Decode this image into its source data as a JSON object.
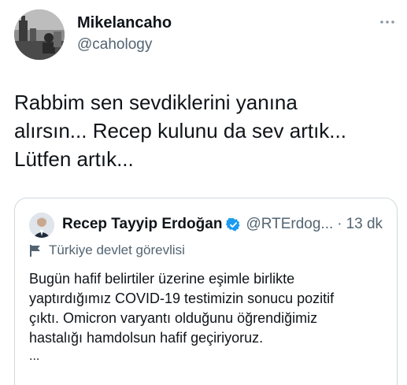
{
  "author": {
    "name": "Mikelancaho",
    "handle": "@cahology"
  },
  "more_icon": "more-horizontal-icon",
  "tweet_text_lines": [
    "Rabbim sen sevdiklerini yanına",
    "alırsın... Recep kulunu da sev artık...",
    "Lütfen artık..."
  ],
  "quoted_tweet": {
    "name": "Recep Tayyip Erdoğan",
    "verified": true,
    "handle": "@RTErdog...",
    "separator": "·",
    "time": "13 dk",
    "label": "Türkiye devlet görevlisi",
    "label_icon": "flag-icon",
    "text_lines": [
      "Bugün hafif belirtiler üzerine eşimle birlikte",
      "yaptırdığımız COVID-19 testimizin sonucu pozitif",
      "çıktı. Omicron varyantı olduğunu öğrendiğimiz",
      "hastalığı hamdolsun hafif geçiriyoruz."
    ],
    "ellipsis": "..."
  },
  "colors": {
    "text": "#0f1419",
    "secondary": "#536471",
    "verified": "#1d9bf0",
    "border": "#cfd9de"
  }
}
